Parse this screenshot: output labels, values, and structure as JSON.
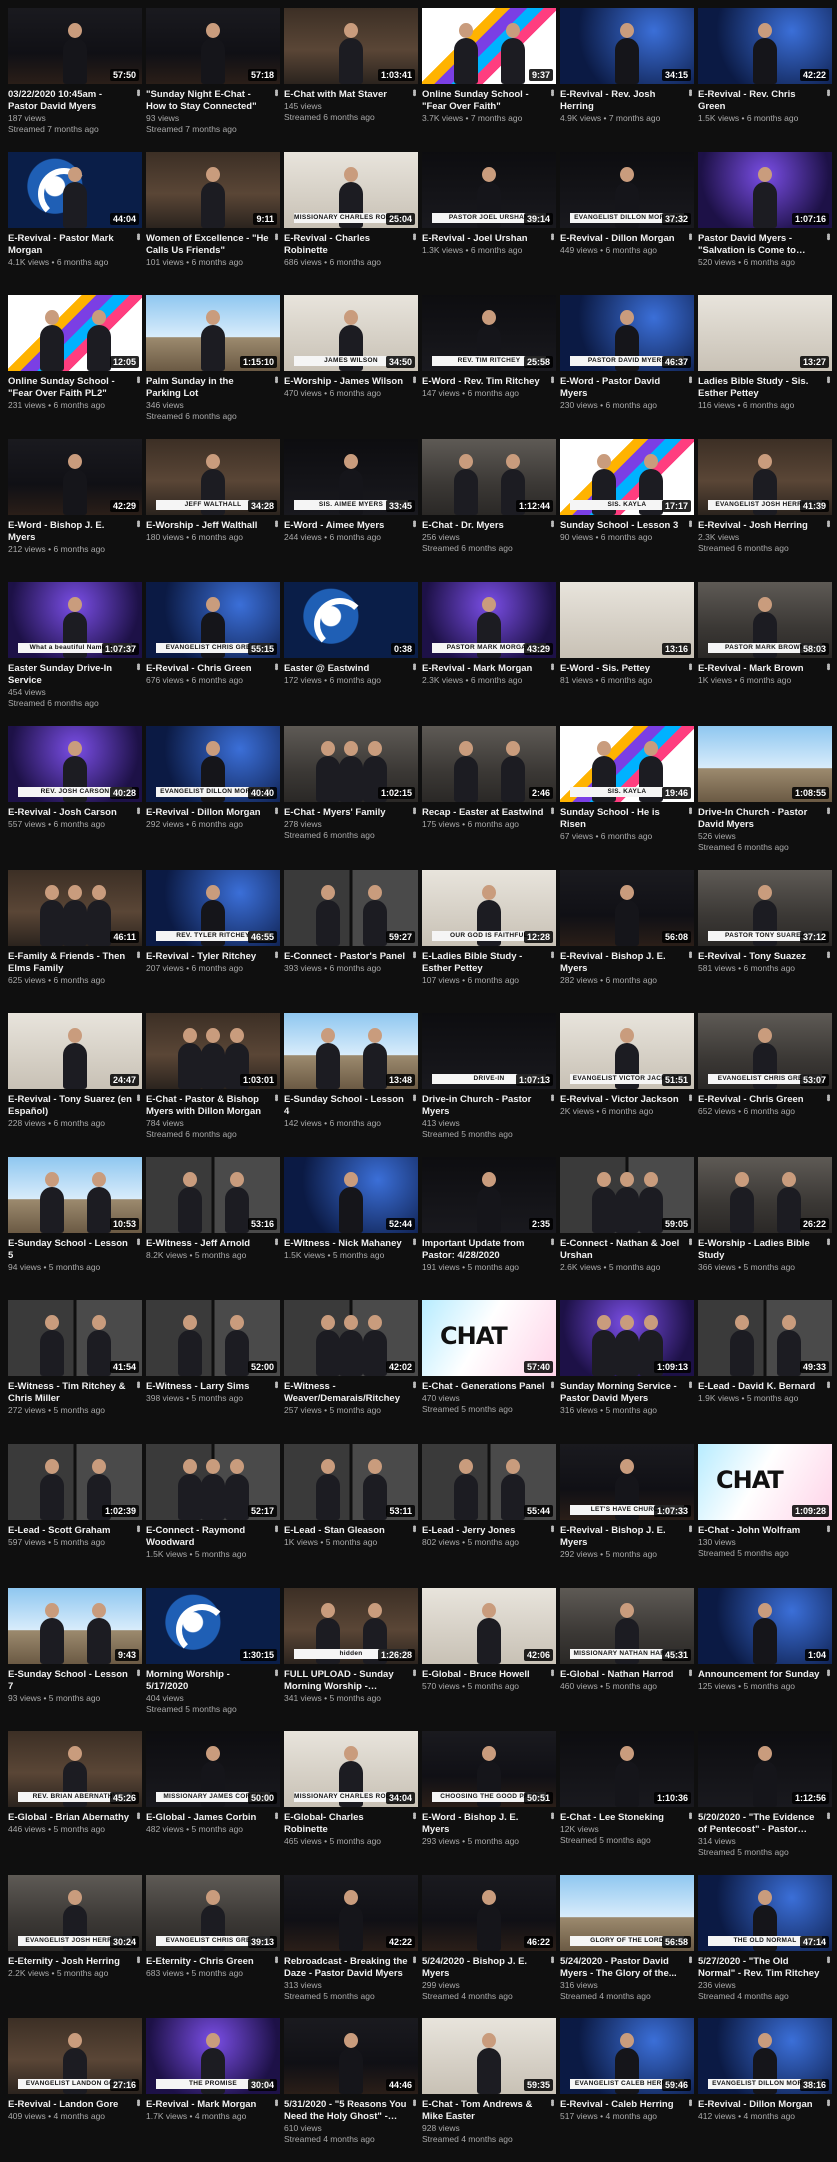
{
  "videos": [
    {
      "title": "03/22/2020 10:45am - Pastor David Myers",
      "views": "187 views",
      "when": "Streamed 7 months ago",
      "duration": "57:50",
      "theme": "stage",
      "figures": 1,
      "banner": ""
    },
    {
      "title": "\"Sunday Night E-Chat - How to Stay Connected\"",
      "views": "93 views",
      "when": "Streamed 7 months ago",
      "duration": "57:18",
      "theme": "stage",
      "figures": 1,
      "banner": ""
    },
    {
      "title": "E-Chat with Mat Staver",
      "views": "145 views",
      "when": "Streamed 6 months ago",
      "duration": "1:03:41",
      "theme": "office",
      "figures": 1,
      "banner": ""
    },
    {
      "title": "Online Sunday School - \"Fear Over Faith\"",
      "views": "3.7K views",
      "when": "7 months ago",
      "duration": "9:37",
      "theme": "bright",
      "figures": 2,
      "banner": ""
    },
    {
      "title": "E-Revival - Rev. Josh Herring",
      "views": "4.9K views",
      "when": "7 months ago",
      "duration": "34:15",
      "theme": "blue",
      "figures": 1,
      "banner": ""
    },
    {
      "title": "E-Revival - Rev. Chris Green",
      "views": "1.5K views",
      "when": "6 months ago",
      "duration": "42:22",
      "theme": "blue",
      "figures": 1,
      "banner": ""
    },
    {
      "title": "E-Revival - Pastor Mark Morgan",
      "views": "4.1K views",
      "when": "6 months ago",
      "duration": "44:04",
      "theme": "swirl",
      "figures": 1,
      "banner": ""
    },
    {
      "title": "Women of Excellence - \"He Calls Us Friends\"",
      "views": "101 views",
      "when": "6 months ago",
      "duration": "9:11",
      "theme": "office",
      "figures": 1,
      "banner": ""
    },
    {
      "title": "E-Revival - Charles Robinette",
      "views": "686 views",
      "when": "6 months ago",
      "duration": "25:04",
      "theme": "light",
      "figures": 1,
      "banner": "MISSIONARY CHARLES ROBINETTE"
    },
    {
      "title": "E-Revival - Joel Urshan",
      "views": "1.3K views",
      "when": "6 months ago",
      "duration": "39:14",
      "theme": "dark",
      "figures": 1,
      "banner": "PASTOR JOEL URSHAN"
    },
    {
      "title": "E-Revival - Dillon Morgan",
      "views": "449 views",
      "when": "6 months ago",
      "duration": "37:32",
      "theme": "dark",
      "figures": 1,
      "banner": "EVANGELIST DILLON MORGAN"
    },
    {
      "title": "Pastor David Myers - \"Salvation is Come to Your...",
      "views": "520 views",
      "when": "6 months ago",
      "duration": "1:07:16",
      "theme": "purple",
      "figures": 1,
      "banner": ""
    },
    {
      "title": "Online Sunday School - \"Fear Over Faith PL2\"",
      "views": "231 views",
      "when": "6 months ago",
      "duration": "12:05",
      "theme": "bright",
      "figures": 2,
      "banner": ""
    },
    {
      "title": "Palm Sunday in the Parking Lot",
      "views": "346 views",
      "when": "Streamed 6 months ago",
      "duration": "1:15:10",
      "theme": "sky",
      "figures": 1,
      "banner": ""
    },
    {
      "title": "E-Worship - James Wilson",
      "views": "470 views",
      "when": "6 months ago",
      "duration": "34:50",
      "theme": "light",
      "figures": 1,
      "banner": "JAMES WILSON"
    },
    {
      "title": "E-Word - Rev. Tim Ritchey",
      "views": "147 views",
      "when": "6 months ago",
      "duration": "25:58",
      "theme": "dark",
      "figures": 1,
      "banner": "REV. TIM RITCHEY"
    },
    {
      "title": "E-Word - Pastor David Myers",
      "views": "230 views",
      "when": "6 months ago",
      "duration": "46:37",
      "theme": "blue",
      "figures": 1,
      "banner": "PASTOR DAVID MYERS"
    },
    {
      "title": "Ladies Bible Study - Sis. Esther Pettey",
      "views": "116 views",
      "when": "6 months ago",
      "duration": "13:27",
      "theme": "light",
      "figures": 0,
      "banner": ""
    },
    {
      "title": "E-Word - Bishop J. E. Myers",
      "views": "212 views",
      "when": "6 months ago",
      "duration": "42:29",
      "theme": "stage",
      "figures": 1,
      "banner": ""
    },
    {
      "title": "E-Worship - Jeff Walthall",
      "views": "180 views",
      "when": "6 months ago",
      "duration": "34:28",
      "theme": "office",
      "figures": 1,
      "banner": "JEFF WALTHALL"
    },
    {
      "title": "E-Word - Aimee Myers",
      "views": "244 views",
      "when": "6 months ago",
      "duration": "33:45",
      "theme": "dark",
      "figures": 1,
      "banner": "SIS. AIMEE MYERS"
    },
    {
      "title": "E-Chat - Dr. Myers",
      "views": "256 views",
      "when": "Streamed 6 months ago",
      "duration": "1:12:44",
      "theme": "room",
      "figures": 2,
      "banner": ""
    },
    {
      "title": "Sunday School - Lesson 3",
      "views": "90 views",
      "when": "6 months ago",
      "duration": "17:17",
      "theme": "bright",
      "figures": 2,
      "banner": "SIS. KAYLA"
    },
    {
      "title": "E-Revival - Josh Herring",
      "views": "2.3K views",
      "when": "Streamed 6 months ago",
      "duration": "41:39",
      "theme": "office",
      "figures": 1,
      "banner": "EVANGELIST JOSH HERRING"
    },
    {
      "title": "Easter Sunday Drive-In Service",
      "views": "454 views",
      "when": "Streamed 6 months ago",
      "duration": "1:07:37",
      "theme": "purple",
      "figures": 1,
      "banner": "What a beautiful Name it is"
    },
    {
      "title": "E-Revival - Chris Green",
      "views": "676 views",
      "when": "6 months ago",
      "duration": "55:15",
      "theme": "blue",
      "figures": 1,
      "banner": "EVANGELIST CHRIS GREEN"
    },
    {
      "title": "Easter @ Eastwind",
      "views": "172 views",
      "when": "6 months ago",
      "duration": "0:38",
      "theme": "swirl",
      "figures": 0,
      "banner": ""
    },
    {
      "title": "E-Revival - Mark Morgan",
      "views": "2.3K views",
      "when": "6 months ago",
      "duration": "43:29",
      "theme": "purple",
      "figures": 1,
      "banner": "PASTOR MARK MORGAN"
    },
    {
      "title": "E-Word - Sis. Pettey",
      "views": "81 views",
      "when": "6 months ago",
      "duration": "13:16",
      "theme": "light",
      "figures": 0,
      "banner": ""
    },
    {
      "title": "E-Revival - Mark Brown",
      "views": "1K views",
      "when": "6 months ago",
      "duration": "58:03",
      "theme": "room",
      "figures": 1,
      "banner": "PASTOR MARK BROWN"
    },
    {
      "title": "E-Revival - Josh Carson",
      "views": "557 views",
      "when": "6 months ago",
      "duration": "40:28",
      "theme": "purple",
      "figures": 1,
      "banner": "REV. JOSH CARSON"
    },
    {
      "title": "E-Revival - Dillon Morgan",
      "views": "292 views",
      "when": "6 months ago",
      "duration": "40:40",
      "theme": "blue",
      "figures": 1,
      "banner": "EVANGELIST DILLON MORGAN"
    },
    {
      "title": "E-Chat - Myers' Family",
      "views": "278 views",
      "when": "Streamed 6 months ago",
      "duration": "1:02:15",
      "theme": "room",
      "figures": 3,
      "banner": ""
    },
    {
      "title": "Recap - Easter at Eastwind",
      "views": "175 views",
      "when": "6 months ago",
      "duration": "2:46",
      "theme": "room",
      "figures": 2,
      "banner": ""
    },
    {
      "title": "Sunday School - He is Risen",
      "views": "67 views",
      "when": "6 months ago",
      "duration": "19:46",
      "theme": "bright",
      "figures": 2,
      "banner": "SIS. KAYLA"
    },
    {
      "title": "Drive-In Church - Pastor David Myers",
      "views": "526 views",
      "when": "Streamed 6 months ago",
      "duration": "1:08:55",
      "theme": "sky",
      "figures": 0,
      "banner": ""
    },
    {
      "title": "E-Family & Friends - Then Elms Family",
      "views": "625 views",
      "when": "6 months ago",
      "duration": "46:11",
      "theme": "office",
      "figures": 3,
      "banner": ""
    },
    {
      "title": "E-Revival - Tyler Ritchey",
      "views": "207 views",
      "when": "6 months ago",
      "duration": "46:55",
      "theme": "blue",
      "figures": 1,
      "banner": "REV. TYLER RITCHEY"
    },
    {
      "title": "E-Connect - Pastor's Panel",
      "views": "393 views",
      "when": "6 months ago",
      "duration": "59:27",
      "theme": "zoom",
      "figures": 2,
      "banner": ""
    },
    {
      "title": "E-Ladies Bible Study - Esther Pettey",
      "views": "107 views",
      "when": "6 months ago",
      "duration": "12:28",
      "theme": "light",
      "figures": 1,
      "banner": "OUR GOD IS FAITHFUL"
    },
    {
      "title": "E-Revival - Bishop J. E. Myers",
      "views": "282 views",
      "when": "6 months ago",
      "duration": "56:08",
      "theme": "stage",
      "figures": 1,
      "banner": ""
    },
    {
      "title": "E-Revival - Tony Suazez",
      "views": "581 views",
      "when": "6 months ago",
      "duration": "37:12",
      "theme": "room",
      "figures": 1,
      "banner": "PASTOR TONY SUAREZ"
    },
    {
      "title": "E-Revival - Tony Suarez (en Español)",
      "views": "228 views",
      "when": "6 months ago",
      "duration": "24:47",
      "theme": "light",
      "figures": 1,
      "banner": ""
    },
    {
      "title": "E-Chat - Pastor & Bishop Myers with Dillon Morgan",
      "views": "784 views",
      "when": "Streamed 6 months ago",
      "duration": "1:03:01",
      "theme": "office",
      "figures": 3,
      "banner": ""
    },
    {
      "title": "E-Sunday School - Lesson 4",
      "views": "142 views",
      "when": "6 months ago",
      "duration": "13:48",
      "theme": "sky",
      "figures": 2,
      "banner": ""
    },
    {
      "title": "Drive-in Church - Pastor Myers",
      "views": "413 views",
      "when": "Streamed 5 months ago",
      "duration": "1:07:13",
      "theme": "dark",
      "figures": 0,
      "banner": "DRIVE-IN"
    },
    {
      "title": "E-Revival - Victor Jackson",
      "views": "2K views",
      "when": "6 months ago",
      "duration": "51:51",
      "theme": "light",
      "figures": 1,
      "banner": "EVANGELIST VICTOR JACKSON"
    },
    {
      "title": "E-Revival - Chris Green",
      "views": "652 views",
      "when": "6 months ago",
      "duration": "53:07",
      "theme": "room",
      "figures": 1,
      "banner": "EVANGELIST CHRIS GREEN"
    },
    {
      "title": "E-Sunday School - Lesson 5",
      "views": "94 views",
      "when": "5 months ago",
      "duration": "10:53",
      "theme": "sky",
      "figures": 2,
      "banner": ""
    },
    {
      "title": "E-Witness - Jeff Arnold",
      "views": "8.2K views",
      "when": "5 months ago",
      "duration": "53:16",
      "theme": "zoom",
      "figures": 2,
      "banner": ""
    },
    {
      "title": "E-Witness - Nick Mahaney",
      "views": "1.5K views",
      "when": "5 months ago",
      "duration": "52:44",
      "theme": "blue",
      "figures": 1,
      "banner": ""
    },
    {
      "title": "Important Update from Pastor: 4/28/2020",
      "views": "191 views",
      "when": "5 months ago",
      "duration": "2:35",
      "theme": "dark",
      "figures": 1,
      "banner": ""
    },
    {
      "title": "E-Connect - Nathan & Joel Urshan",
      "views": "2.6K views",
      "when": "5 months ago",
      "duration": "59:05",
      "theme": "zoom",
      "figures": 3,
      "banner": ""
    },
    {
      "title": "E-Worship - Ladies Bible Study",
      "views": "366 views",
      "when": "5 months ago",
      "duration": "26:22",
      "theme": "room",
      "figures": 2,
      "banner": ""
    },
    {
      "title": "E-Witness - Tim Ritchey & Chris Miller",
      "views": "272 views",
      "when": "5 months ago",
      "duration": "41:54",
      "theme": "zoom",
      "figures": 2,
      "banner": ""
    },
    {
      "title": "E-Witness - Larry Sims",
      "views": "398 views",
      "when": "5 months ago",
      "duration": "52:00",
      "theme": "zoom",
      "figures": 2,
      "banner": ""
    },
    {
      "title": "E-Witness - Weaver/Demarais/Ritchey",
      "views": "257 views",
      "when": "5 months ago",
      "duration": "42:02",
      "theme": "zoom",
      "figures": 3,
      "banner": ""
    },
    {
      "title": "E-Chat - Generations Panel",
      "views": "470 views",
      "when": "Streamed 5 months ago",
      "duration": "57:40",
      "theme": "chat",
      "figures": 0,
      "banner": ""
    },
    {
      "title": "Sunday Morning Service - Pastor David Myers",
      "views": "316 views",
      "when": "5 months ago",
      "duration": "1:09:13",
      "theme": "purple",
      "figures": 3,
      "banner": ""
    },
    {
      "title": "E-Lead - David K. Bernard",
      "views": "1.9K views",
      "when": "5 months ago",
      "duration": "49:33",
      "theme": "zoom",
      "figures": 2,
      "banner": ""
    },
    {
      "title": "E-Lead - Scott Graham",
      "views": "597 views",
      "when": "5 months ago",
      "duration": "1:02:39",
      "theme": "zoom",
      "figures": 2,
      "banner": ""
    },
    {
      "title": "E-Connect - Raymond Woodward",
      "views": "1.5K views",
      "when": "5 months ago",
      "duration": "52:17",
      "theme": "zoom",
      "figures": 3,
      "banner": ""
    },
    {
      "title": "E-Lead - Stan Gleason",
      "views": "1K views",
      "when": "5 months ago",
      "duration": "53:11",
      "theme": "zoom",
      "figures": 2,
      "banner": ""
    },
    {
      "title": "E-Lead - Jerry Jones",
      "views": "802 views",
      "when": "5 months ago",
      "duration": "55:44",
      "theme": "zoom",
      "figures": 2,
      "banner": ""
    },
    {
      "title": "E-Revival - Bishop J. E. Myers",
      "views": "292 views",
      "when": "5 months ago",
      "duration": "1:07:33",
      "theme": "stage",
      "figures": 1,
      "banner": "LET'S HAVE CHURCH"
    },
    {
      "title": "E-Chat - John Wolfram",
      "views": "130 views",
      "when": "Streamed 5 months ago",
      "duration": "1:09:28",
      "theme": "chat",
      "figures": 0,
      "banner": ""
    },
    {
      "title": "E-Sunday School - Lesson 7",
      "views": "93 views",
      "when": "5 months ago",
      "duration": "9:43",
      "theme": "sky",
      "figures": 2,
      "banner": ""
    },
    {
      "title": "Morning Worship - 5/17/2020",
      "views": "404 views",
      "when": "Streamed 5 months ago",
      "duration": "1:30:15",
      "theme": "swirl",
      "figures": 0,
      "banner": ""
    },
    {
      "title": "FULL UPLOAD - Sunday Morning Worship - 5/10/2020",
      "views": "341 views",
      "when": "5 months ago",
      "duration": "1:26:28",
      "theme": "office",
      "figures": 2,
      "banner": "hidden"
    },
    {
      "title": "E-Global - Bruce Howell",
      "views": "570 views",
      "when": "5 months ago",
      "duration": "42:06",
      "theme": "light",
      "figures": 1,
      "banner": ""
    },
    {
      "title": "E-Global - Nathan Harrod",
      "views": "460 views",
      "when": "5 months ago",
      "duration": "45:31",
      "theme": "room",
      "figures": 1,
      "banner": "MISSIONARY NATHAN HARROD"
    },
    {
      "title": "Announcement for Sunday",
      "views": "125 views",
      "when": "5 months ago",
      "duration": "1:04",
      "theme": "blue",
      "figures": 1,
      "banner": ""
    },
    {
      "title": "E-Global - Brian Abernathy",
      "views": "446 views",
      "when": "5 months ago",
      "duration": "45:26",
      "theme": "office",
      "figures": 1,
      "banner": "REV. BRIAN ABERNATHY"
    },
    {
      "title": "E-Global - James Corbin",
      "views": "482 views",
      "when": "5 months ago",
      "duration": "50:00",
      "theme": "dark",
      "figures": 1,
      "banner": "MISSIONARY JAMES CORBIN"
    },
    {
      "title": "E-Global- Charles Robinette",
      "views": "465 views",
      "when": "5 months ago",
      "duration": "34:04",
      "theme": "light",
      "figures": 1,
      "banner": "MISSIONARY CHARLES ROBINETTE"
    },
    {
      "title": "E-Word - Bishop J. E. Myers",
      "views": "293 views",
      "when": "5 months ago",
      "duration": "50:51",
      "theme": "stage",
      "figures": 1,
      "banner": "CHOOSING THE GOOD PART"
    },
    {
      "title": "E-Chat - Lee Stoneking",
      "views": "12K views",
      "when": "Streamed 5 months ago",
      "duration": "1:10:36",
      "theme": "dark",
      "figures": 1,
      "banner": ""
    },
    {
      "title": "5/20/2020 - \"The Evidence of Pentecost\" - Pastor David...",
      "views": "314 views",
      "when": "Streamed 5 months ago",
      "duration": "1:12:56",
      "theme": "dark",
      "figures": 1,
      "banner": ""
    },
    {
      "title": "E-Eternity - Josh Herring",
      "views": "2.2K views",
      "when": "5 months ago",
      "duration": "30:24",
      "theme": "room",
      "figures": 1,
      "banner": "EVANGELIST JOSH HERRING"
    },
    {
      "title": "E-Eternity - Chris Green",
      "views": "683 views",
      "when": "5 months ago",
      "duration": "39:13",
      "theme": "room",
      "figures": 1,
      "banner": "EVANGELIST CHRIS GREEN"
    },
    {
      "title": "Rebroadcast - Breaking the Daze - Pastor David Myers",
      "views": "313 views",
      "when": "Streamed 5 months ago",
      "duration": "42:22",
      "theme": "stage",
      "figures": 1,
      "banner": ""
    },
    {
      "title": "5/24/2020 - Bishop J. E. Myers",
      "views": "299 views",
      "when": "Streamed 4 months ago",
      "duration": "46:22",
      "theme": "stage",
      "figures": 1,
      "banner": ""
    },
    {
      "title": "5/24/2020 - Pastor David Myers - The Glory of the...",
      "views": "316 views",
      "when": "Streamed 4 months ago",
      "duration": "56:58",
      "theme": "sky",
      "figures": 0,
      "banner": "GLORY OF THE LORD"
    },
    {
      "title": "5/27/2020 - \"The Old Normal\" - Rev. Tim Ritchey",
      "views": "236 views",
      "when": "Streamed 4 months ago",
      "duration": "47:14",
      "theme": "blue",
      "figures": 1,
      "banner": "THE OLD NORMAL"
    },
    {
      "title": "E-Revival - Landon Gore",
      "views": "409 views",
      "when": "4 months ago",
      "duration": "27:16",
      "theme": "office",
      "figures": 1,
      "banner": "EVANGELIST LANDON GORE"
    },
    {
      "title": "E-Revival - Mark Morgan",
      "views": "1.7K views",
      "when": "4 months ago",
      "duration": "30:04",
      "theme": "purple",
      "figures": 1,
      "banner": "THE PROMISE"
    },
    {
      "title": "5/31/2020 - \"5 Reasons You Need the Holy Ghost\" - Rev....",
      "views": "610 views",
      "when": "Streamed 4 months ago",
      "duration": "44:46",
      "theme": "stage",
      "figures": 1,
      "banner": ""
    },
    {
      "title": "E-Chat - Tom Andrews & Mike Easter",
      "views": "928 views",
      "when": "Streamed 4 months ago",
      "duration": "59:35",
      "theme": "light",
      "figures": 1,
      "banner": ""
    },
    {
      "title": "E-Revival - Caleb Herring",
      "views": "517 views",
      "when": "4 months ago",
      "duration": "59:46",
      "theme": "blue",
      "figures": 1,
      "banner": "EVANGELIST CALEB HERRING"
    },
    {
      "title": "E-Revival - Dillon Morgan",
      "views": "412 views",
      "when": "4 months ago",
      "duration": "38:16",
      "theme": "blue",
      "figures": 1,
      "banner": "EVANGELIST DILLON MORGAN"
    }
  ],
  "menu_icon_glyph": "•••",
  "chat_logo_text": "CHAT"
}
